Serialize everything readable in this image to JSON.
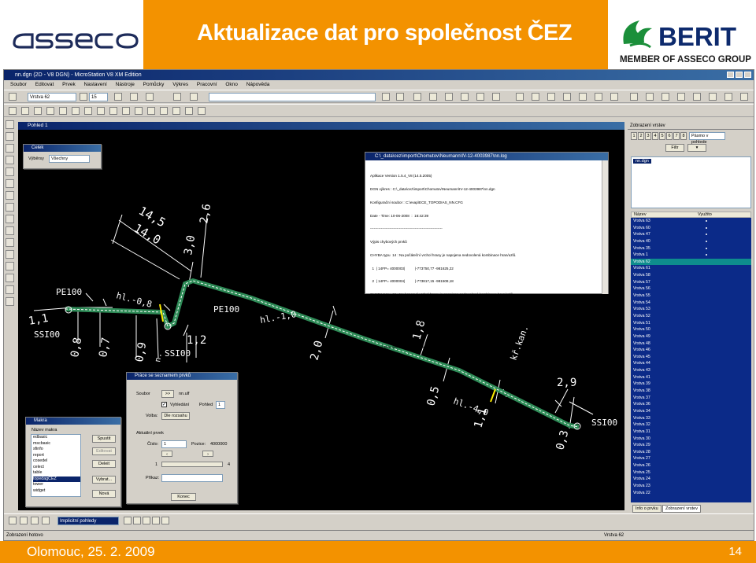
{
  "slide": {
    "title": "Aktualizace dat pro společnost ČEZ",
    "brand_left": "asseco",
    "brand_right": "BERIT",
    "brand_right_sub": "MEMBER OF ASSECO GROUP",
    "footer_place": "Olomouc,   25. 2. 2009",
    "page_number": "14",
    "accent_color": "#f39200"
  },
  "app": {
    "title": "nn.dgn (2D - V8 DGN) - MicroStation V8 XM Edition",
    "menu": [
      "Soubor",
      "Editovat",
      "Prvek",
      "Nastavení",
      "Nástroje",
      "Pomůcky",
      "Výkres",
      "Pracovní",
      "Okno",
      "Nápověda"
    ],
    "active_level": "Vrstva 62",
    "line_weight": "15",
    "view_title": "Pohled 1",
    "status_text": "Zobrazení hotovo",
    "status_level": "Vrstva 62",
    "view_combo": "Implicitní pohledy"
  },
  "cad_labels": {
    "dim_14_5": "14,5",
    "dim_14_0": "14,0",
    "dim_2_6": "2,6",
    "dim_3_0": "3,0",
    "pe100_a": "PE100",
    "pe100_b": "PE100",
    "hl_08": "hl.-0,8",
    "hl_10": "hl.-1,0",
    "hl_40": "hl.-4,0",
    "dim_1_1a": "1,1",
    "dim_0_8": "0,8",
    "dim_0_7": "0,7",
    "dim_0_9": "0,9",
    "dim_1_2": "1,2",
    "ssi00_a": "SSI00",
    "ssi00_b": "SSI00",
    "ssi00_c": "SSI00",
    "dim_2_0": "2,0",
    "dim_1_8": "1,8",
    "kr_kan": "kř.kan.",
    "dim_0_5": "0,5",
    "dim_1_1b": "1,1",
    "dim_2_9": "2,9",
    "dim_0_3": "0,3",
    "n_label": "n."
  },
  "dialog_celek": {
    "title": "Celek",
    "label": "Výběrsy",
    "value": "Všechny"
  },
  "dialog_makra": {
    "title": "Makra",
    "list_label": "Název makra",
    "items": [
      "edbasic",
      "mscbasic",
      "sfinfo",
      "report",
      "cosedel",
      "celect",
      "table",
      "topedagCEZ",
      "tower",
      "widget"
    ],
    "selected_index": 7,
    "buttons": [
      "Spustit",
      "Editovat",
      "Deleit",
      "Vybrat...",
      "Nová"
    ]
  },
  "dialog_prace": {
    "title": "Práce se seznamem prvků",
    "soubor_label": "Soubor",
    "soubor_value": "nn.ulf",
    "btn_browse": ">>",
    "check_label": "Vyhledání",
    "pohled_label": "Pohled",
    "pohled_value": "1",
    "volba_label": "Volba:",
    "volba_value": "Dle rozsahu",
    "section": "Aktuální prvek",
    "cislo_label": "Číslo:",
    "cislo_value": "1",
    "pozice_label": "Pozice:",
    "pozice_value": "4000000",
    "range_from": "1",
    "range_to": "4",
    "prikaz_label": "Příkaz:",
    "close": "Konec"
  },
  "log_window": {
    "title": "C:\\_data\\cez\\import\\Chomutov\\Neumann\\IV-12-4003987\\nn.log",
    "lines": [
      "Aplikace Version 1.5.4_V8 (14.5.2005)",
      "DGN výkres : C:\\_data\\cez\\import\\Chomutov\\Neumann\\IV-12-4003987\\nn.dgn",
      "Konfigurační soubor : C:\\evap\\ECE_TOPODIAS_NN.CFG",
      "Date - Time: 10-06-2008  :  16:42:39",
      "------------------------------------------------------------",
      "Výpis chybových prvků",
      "CHYBA typu  14 : Na počáteční vrchol hrany je napojena nedovolená kombinace hran/uzlů.",
      "  1  | 14FP= 4000003|          |-773750,77 -981625,22",
      "  2  | 14FP= 4000004|          |-773817,15 -981508,18",
      "CHYBA typu  15 : Na koncový vrchol hrany je napojena nedovolená kombinace hran/uzlů.",
      "  3  | 15FP= 4000003|          |-773817,15 -981508,18",
      "  4  | 15FP= 4000004|          |-773834,81 -981504,89",
      "------------------------------------------------------------",
      "Celkově bylo ověřeno  : 19 grafických elementů",
      "Bylo nalezeno celkem: 4 chyb",
      "Date - Time: 10-06-2008  :  16:42:41"
    ]
  },
  "right_panel": {
    "title": "Zobrazení vrstev",
    "filter": "Filtr",
    "combo": "Pásmo v pohlede",
    "view_buttons": [
      "1",
      "2",
      "3",
      "4",
      "5",
      "6",
      "7",
      "8"
    ],
    "tree_item": "nn.dgn",
    "col_name": "Název",
    "col_used": "Využito",
    "layers": [
      "Vrstva 63",
      "Vrstva 60",
      "Vrstva 47",
      "Vrstva 40",
      "Vrstva 35",
      "Vrstva 1",
      "Vrstva 62",
      "Vrstva 61",
      "Vrstva 58",
      "Vrstva 57",
      "Vrstva 56",
      "Vrstva 55",
      "Vrstva 54",
      "Vrstva 53",
      "Vrstva 52",
      "Vrstva 51",
      "Vrstva 50",
      "Vrstva 49",
      "Vrstva 48",
      "Vrstva 46",
      "Vrstva 45",
      "Vrstva 44",
      "Vrstva 43",
      "Vrstva 41",
      "Vrstva 39",
      "Vrstva 38",
      "Vrstva 37",
      "Vrstva 36",
      "Vrstva 34",
      "Vrstva 33",
      "Vrstva 32",
      "Vrstva 31",
      "Vrstva 30",
      "Vrstva 29",
      "Vrstva 28",
      "Vrstva 27",
      "Vrstva 26",
      "Vrstva 25",
      "Vrstva 24",
      "Vrstva 23",
      "Vrstva 22"
    ],
    "used_count": 6,
    "selected_index": 6,
    "tabs": [
      "Info o prvku",
      "Zobrazení vrstev"
    ]
  }
}
